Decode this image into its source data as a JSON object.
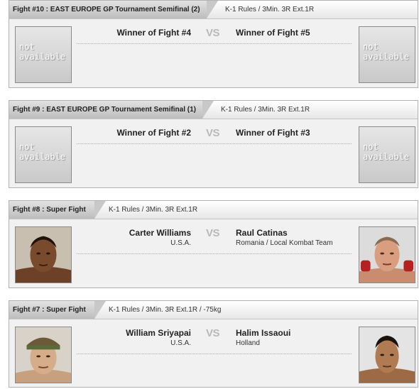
{
  "fights": [
    {
      "title": "Fight #10 : EAST EUROPE GP Tournament Semifinal (2)",
      "rules": "K-1 Rules / 3Min. 3R Ext.1R",
      "vs": "VS",
      "left": {
        "name": "Winner of Fight #4",
        "country": "",
        "photo": "not available"
      },
      "right": {
        "name": "Winner of Fight #5",
        "country": "",
        "photo": "not available"
      }
    },
    {
      "title": "Fight #9 : EAST EUROPE GP Tournament Semifinal (1)",
      "rules": "K-1 Rules / 3Min. 3R Ext.1R",
      "vs": "VS",
      "left": {
        "name": "Winner of Fight #2",
        "country": "",
        "photo": "not available"
      },
      "right": {
        "name": "Winner of Fight #3",
        "country": "",
        "photo": "not available"
      }
    },
    {
      "title": "Fight #8 : Super Fight",
      "rules": "K-1 Rules / 3Min. 3R Ext.1R",
      "vs": "VS",
      "left": {
        "name": "Carter Williams",
        "country": "U.S.A."
      },
      "right": {
        "name": "Raul Catinas",
        "country": "Romania / Local Kombat Team"
      }
    },
    {
      "title": "Fight #7 : Super Fight",
      "rules": "K-1 Rules / 3Min. 3R Ext.1R / -75kg",
      "vs": "VS",
      "left": {
        "name": "William Sriyapai",
        "country": "U.S.A."
      },
      "right": {
        "name": "Halim Issaoui",
        "country": "Holland"
      }
    }
  ]
}
